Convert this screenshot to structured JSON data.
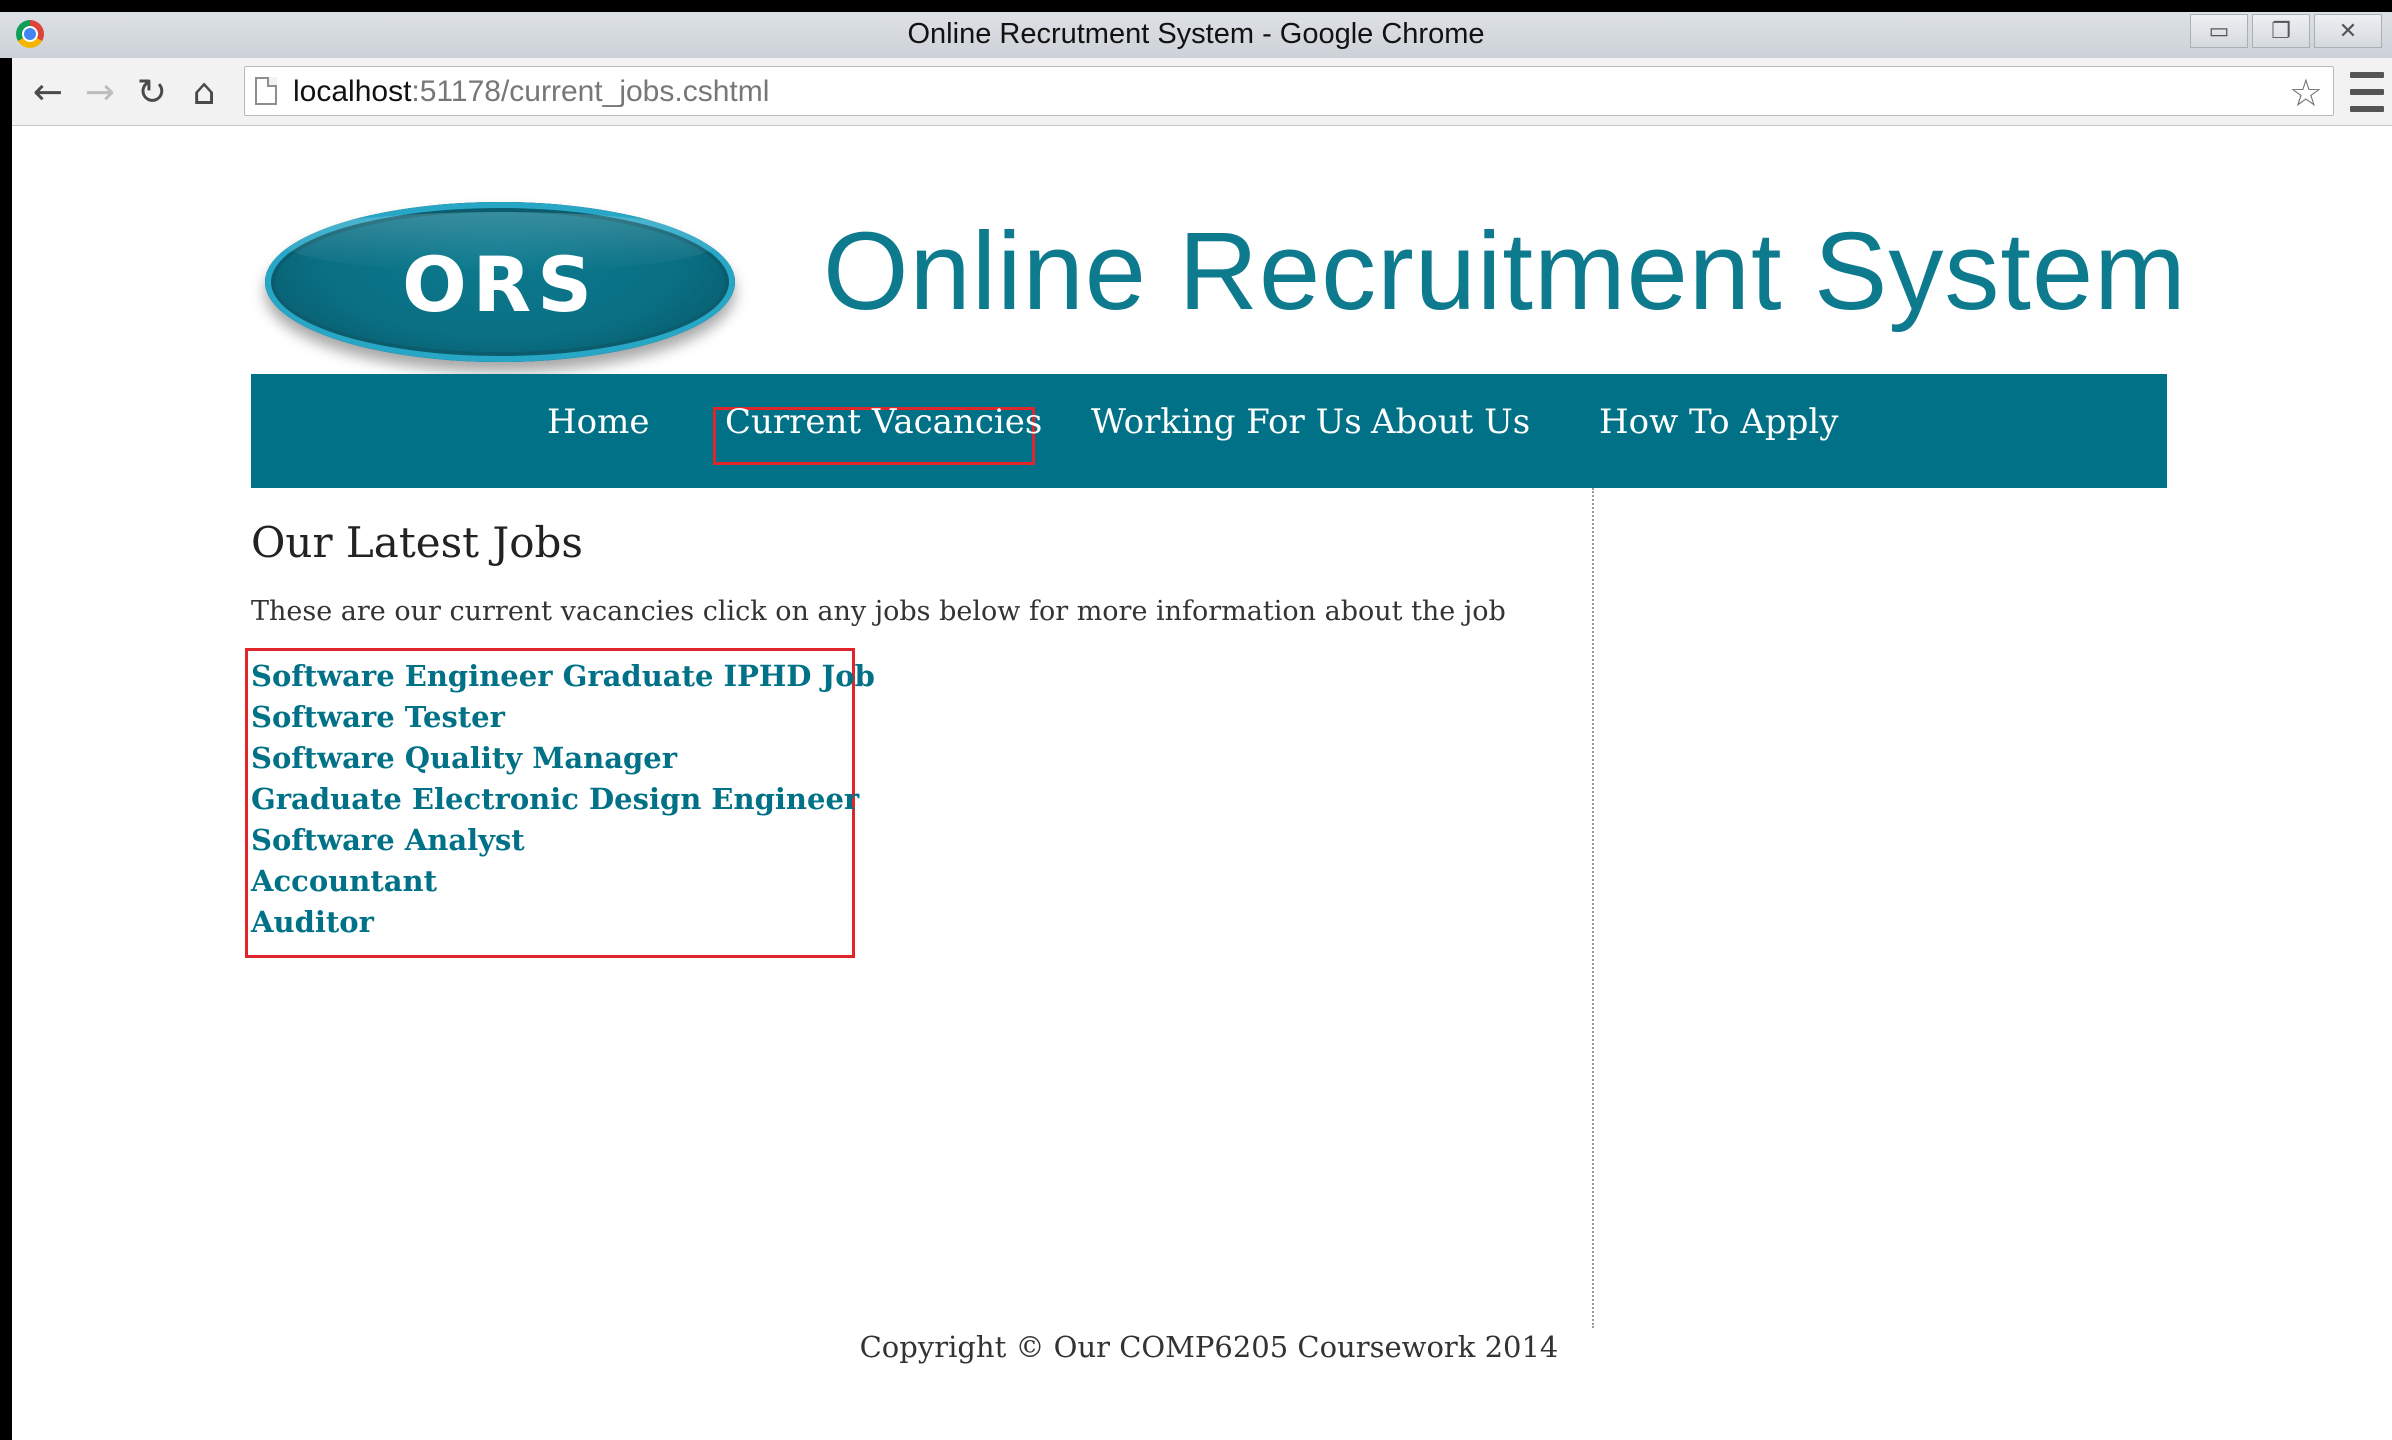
{
  "window": {
    "title": "Online Recrutment System - Google Chrome",
    "minimize": "▭",
    "restore": "❐",
    "close": "✕"
  },
  "toolbar": {
    "back_icon": "arrow-left",
    "forward_icon": "arrow-right",
    "reload_icon": "reload",
    "home_icon": "home",
    "url_host": "localhost",
    "url_path": ":51178/current_jobs.cshtml"
  },
  "site": {
    "logo_text": "ORS",
    "title": "Online Recruitment System",
    "nav": [
      {
        "label": "Home"
      },
      {
        "label": "Current Vacancies",
        "active": true
      },
      {
        "label": "Working For Us"
      },
      {
        "label": "About Us"
      },
      {
        "label": "How To Apply"
      }
    ],
    "heading": "Our Latest Jobs",
    "intro": "These are our current vacancies click on any jobs below for more information about the job",
    "jobs": [
      "Software Engineer Graduate IPHD Job",
      "Software Tester",
      "Software Quality Manager",
      "Graduate Electronic Design Engineer",
      "Software Analyst",
      "Accountant",
      "Auditor"
    ],
    "footer": "Copyright © Our COMP6205 Coursework 2014"
  },
  "colors": {
    "brand_teal": "#007186",
    "title_teal": "#0d7a8d",
    "highlight_red": "#e0252b"
  }
}
